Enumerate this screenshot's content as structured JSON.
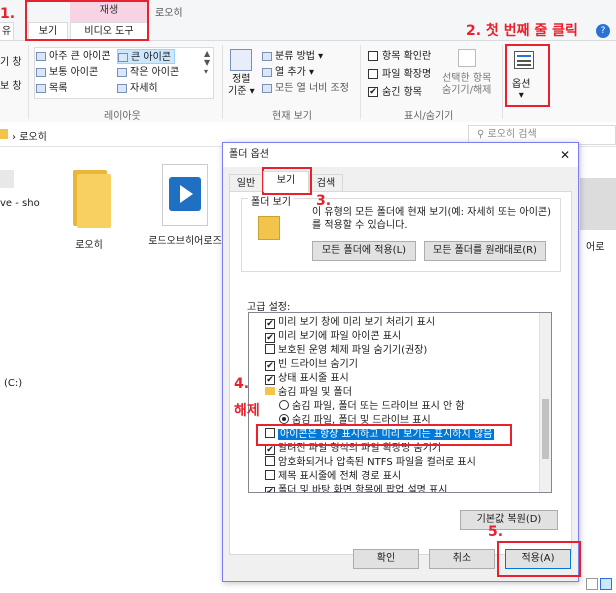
{
  "ribbon": {
    "play_header": "재생",
    "tabs": [
      "보기",
      "비디오 도구"
    ],
    "window_title": "로오히",
    "left_partial": [
      "기 창",
      "보 창"
    ],
    "share_partial": "유",
    "layout": {
      "items_col1": [
        "아주 큰 아이콘",
        "보통 아이콘",
        "목록"
      ],
      "items_col2": [
        "큰 아이콘",
        "작은 아이콘",
        "자세히"
      ],
      "label": "레이아웃"
    },
    "current_view": {
      "sort_label": "정렬\n기준",
      "sort_label_1": "정렬",
      "sort_label_2": "기준",
      "items": [
        "분류 방법",
        "열 추가",
        "모든 열 너비 조정"
      ],
      "label": "현재 보기"
    },
    "show_hide": {
      "items": [
        "항목 확인란",
        "파일 확장명",
        "숨긴 항목"
      ],
      "hide_selected_1": "선택한 항목",
      "hide_selected_2": "숨기기/해제",
      "label": "표시/숨기기"
    },
    "options_label": "옵션"
  },
  "address": {
    "path": "로오히",
    "search_placeholder": "로오히 검색"
  },
  "files": [
    {
      "name": "로오히"
    },
    {
      "name": "로드오브히어로즈"
    }
  ],
  "left_pane": {
    "partial_text": "ve - sho",
    "drive": "(C:)"
  },
  "right_partial_label": "어로",
  "dialog": {
    "title": "폴더 옵션",
    "close": "✕",
    "tabs": [
      "일반",
      "보기",
      "검색"
    ],
    "folder_view_label": "폴더 보기",
    "folder_view_desc": "이 유형의 모든 폴더에 현재 보기(예: 자세히 또는 아이콘)를 적용할 수 있습니다.",
    "apply_all_button": "모든 폴더에 적용(L)",
    "reset_button": "모든 폴더를 원래대로(R)",
    "advanced_label": "고급 설정:",
    "tree_items": [
      {
        "text": "미리 보기 창에 미리 보기 처리기 표시",
        "kind": "check",
        "checked": true
      },
      {
        "text": "미리 보기에 파일 아이콘 표시",
        "kind": "check",
        "checked": true
      },
      {
        "text": "보호된 운영 체제 파일 숨기기(권장)",
        "kind": "check",
        "checked": false
      },
      {
        "text": "빈 드라이브 숨기기",
        "kind": "check",
        "checked": true
      },
      {
        "text": "상태 표시줄 표시",
        "kind": "check",
        "checked": true
      },
      {
        "text": "숨김 파일 및 폴더",
        "kind": "folder"
      },
      {
        "text": "숨김 파일, 폴더 또는 드라이브 표시 안 함",
        "kind": "radio",
        "checked": false
      },
      {
        "text": "숨김 파일, 폴더 및 드라이브 표시",
        "kind": "radio",
        "checked": true
      },
      {
        "text": "아이콘은 항상 표시하고 미리 보기는 표시하지 않음",
        "kind": "check",
        "checked": false,
        "selected": true
      },
      {
        "text": "알려진 파일 형식의 파일 확장명 숨기기",
        "kind": "check",
        "checked": true
      },
      {
        "text": "암호화되거나 압축된 NTFS 파일을 컬러로 표시",
        "kind": "check",
        "checked": false
      },
      {
        "text": "제목 표시줄에 전체 경로 표시",
        "kind": "check",
        "checked": false
      },
      {
        "text": "폴더 및 바탕 화면 항목에 팝업 설명 표시",
        "kind": "check",
        "checked": true
      }
    ],
    "restore_defaults_button": "기본값 복원(D)",
    "ok_button": "확인",
    "cancel_button": "취소",
    "apply_button": "적용(A)"
  },
  "annotations": {
    "step1": "1.",
    "step2": "2. 첫 번째 줄 클릭",
    "step3": "3.",
    "step4": "4.",
    "step4_text": "해제",
    "step5": "5."
  },
  "colors": {
    "annotation_red": "#e8212e",
    "dialog_border": "#7a7ff0",
    "selection_blue": "#0078d7",
    "folder_yellow": "#f3c44b",
    "play_tab_pink": "#f8d3e3"
  }
}
